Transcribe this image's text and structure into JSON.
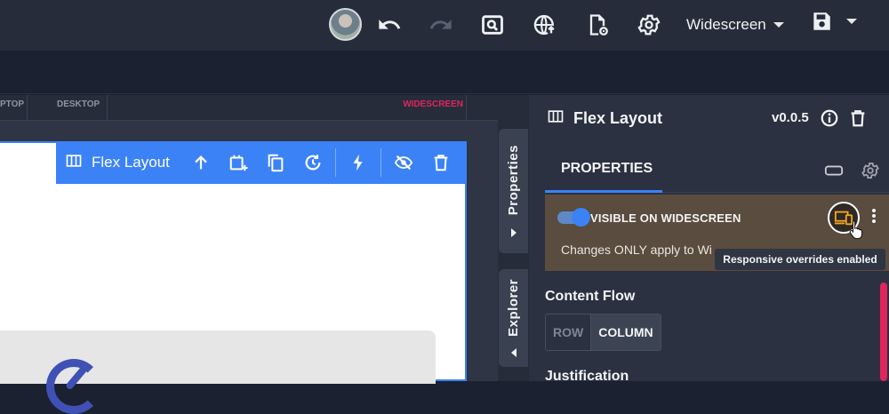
{
  "topbar": {
    "device_label": "Widescreen"
  },
  "ruler": {
    "segments": [
      "PTOP",
      "DESKTOP",
      "WIDESCREEN"
    ]
  },
  "toolbar": {
    "title": "Flex Layout"
  },
  "vtabs": {
    "properties": "Properties",
    "explorer": "Explorer"
  },
  "panel": {
    "title": "Flex Layout",
    "version": "v0.0.5",
    "tab_properties": "PROPERTIES",
    "visible_label": "VISIBLE ON WIDESCREEN",
    "visible_desc": "Changes ONLY apply to Wi",
    "tooltip": "Responsive overrides enabled",
    "content_flow_label": "Content Flow",
    "flow_options": [
      "ROW",
      "COLUMN"
    ],
    "justification_label": "Justification"
  },
  "colors": {
    "accent": "#3b82f6",
    "widescreen": "#e0245e",
    "override_box": "#5a4c3e",
    "responsive_icon": "#f5a623"
  }
}
